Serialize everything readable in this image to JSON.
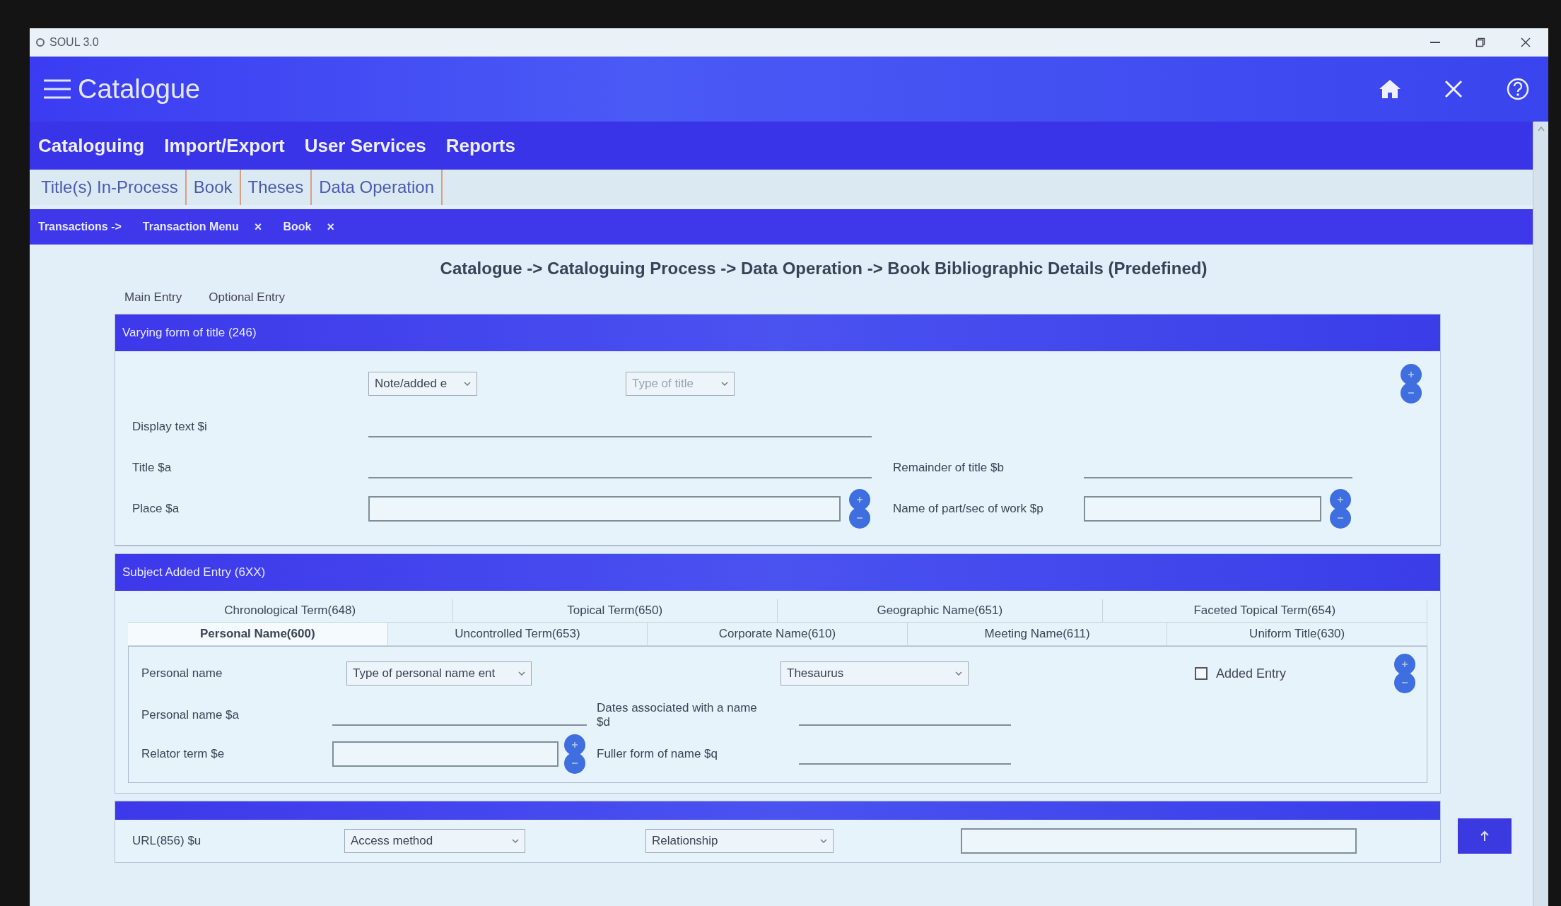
{
  "window": {
    "title": "SOUL 3.0"
  },
  "header": {
    "title": "Catalogue"
  },
  "menu": [
    {
      "label": "Cataloguing"
    },
    {
      "label": "Import/Export"
    },
    {
      "label": "User Services"
    },
    {
      "label": "Reports"
    }
  ],
  "module_tabs": [
    {
      "label": "Title(s) In-Process"
    },
    {
      "label": "Book"
    },
    {
      "label": "Theses"
    },
    {
      "label": "Data Operation"
    }
  ],
  "open_tabs": [
    {
      "label": "Transactions ->"
    },
    {
      "label": "Transaction Menu",
      "close": "×"
    },
    {
      "label": "Book",
      "close": "×"
    }
  ],
  "page_title": "Catalogue -> Cataloguing Process -> Data Operation -> Book Bibliographic Details (Predefined)",
  "entry_tabs": [
    {
      "label": "Main Entry"
    },
    {
      "label": "Optional Entry"
    }
  ],
  "sections": [
    {
      "kind": "varying",
      "title": "Varying form of title (246)",
      "controls": [
        {
          "kind": "select",
          "text": "Note/added e",
          "dimmed": false
        },
        {
          "kind": "select",
          "text": "Type of title",
          "dimmed": true
        }
      ],
      "rows": [
        {
          "left": {
            "label": "Display text $i",
            "kind": "line"
          }
        },
        {
          "left": {
            "label": "Title $a",
            "kind": "line"
          },
          "right": {
            "label": "Remainder of title $b",
            "kind": "line"
          }
        },
        {
          "left": {
            "label": "Place $a",
            "kind": "box"
          },
          "right": {
            "label": "Name of part/sec of work $p",
            "kind": "box"
          }
        }
      ]
    },
    {
      "kind": "subject",
      "title": "Subject Added Entry (6XX)",
      "tab_rows": [
        [
          {
            "label": "Chronological Term(648)",
            "selected": false
          },
          {
            "label": "Topical Term(650)",
            "selected": false
          },
          {
            "label": "Geographic Name(651)",
            "selected": false
          },
          {
            "label": "Faceted Topical Term(654)",
            "selected": false
          }
        ],
        [
          {
            "label": "Personal Name(600)",
            "selected": true
          },
          {
            "label": "Uncontrolled Term(653)",
            "selected": false
          },
          {
            "label": "Corporate Name(610)",
            "selected": false
          },
          {
            "label": "Meeting Name(611)",
            "selected": false
          },
          {
            "label": "Uniform Title(630)",
            "selected": false
          }
        ]
      ],
      "label": "Personal name",
      "controls": [
        {
          "kind": "select",
          "text": "Type of personal name ent",
          "dimmed": false
        },
        {
          "kind": "select",
          "text": "Thesaurus",
          "dimmed": false
        },
        {
          "kind": "checkbox",
          "text": "Added Entry",
          "checked": false
        }
      ],
      "rows": [
        {
          "left": {
            "label": "Personal name $a",
            "kind": "line"
          },
          "right": {
            "label": "Dates associated with a name $d",
            "kind": "line"
          }
        },
        {
          "left": {
            "label": "Relator term $e",
            "kind": "box"
          },
          "right": {
            "label": "Fuller form of name $q",
            "kind": "line"
          }
        }
      ]
    },
    {
      "kind": "links",
      "label": "URL(856) $u",
      "controls": [
        {
          "kind": "select",
          "text": "Access method",
          "dimmed": false
        },
        {
          "kind": "select",
          "text": "Relationship",
          "dimmed": false
        },
        {
          "kind": "box"
        }
      ]
    }
  ]
}
